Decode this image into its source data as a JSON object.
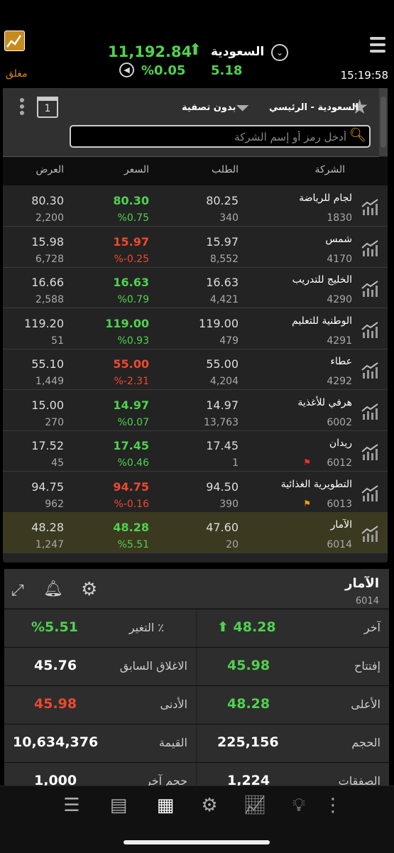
{
  "header": {
    "market_name": "السعودية",
    "index_value": "11,192.84",
    "change_pct": "%0.05",
    "change_value": "5.18",
    "time": "15:19:58",
    "status": "مغلق"
  },
  "filter_bar": {
    "market": "السعودية - الرئيسي",
    "filter": "بدون تصفية",
    "calendar_day": "1"
  },
  "search": {
    "placeholder": "أدخل رمز أو إسم الشركة"
  },
  "table": {
    "columns": [
      "الشركة",
      "الطلب",
      "السعر",
      "العرض"
    ],
    "rows": [
      {
        "name": "لجام للرياضة",
        "symbol": "1830",
        "bid": "80.25",
        "bid_qty": "340",
        "price": "80.30",
        "change": "%0.75",
        "ask": "80.30",
        "ask_qty": "2,200",
        "dir": "up",
        "flag": ""
      },
      {
        "name": "شمس",
        "symbol": "4170",
        "bid": "15.97",
        "bid_qty": "8,552",
        "price": "15.97",
        "change": "%-0.25",
        "ask": "15.98",
        "ask_qty": "6,728",
        "dir": "down",
        "flag": ""
      },
      {
        "name": "الخليج للتدريب",
        "symbol": "4290",
        "bid": "16.63",
        "bid_qty": "4,421",
        "price": "16.63",
        "change": "%0.79",
        "ask": "16.66",
        "ask_qty": "2,588",
        "dir": "up",
        "flag": ""
      },
      {
        "name": "الوطنية للتعليم",
        "symbol": "4291",
        "bid": "119.00",
        "bid_qty": "479",
        "price": "119.00",
        "change": "%0.93",
        "ask": "119.20",
        "ask_qty": "51",
        "dir": "up",
        "flag": ""
      },
      {
        "name": "عطاء",
        "symbol": "4292",
        "bid": "55.00",
        "bid_qty": "4,204",
        "price": "55.00",
        "change": "%-2.31",
        "ask": "55.10",
        "ask_qty": "1,449",
        "dir": "down",
        "flag": ""
      },
      {
        "name": "هرفي للأغذية",
        "symbol": "6002",
        "bid": "14.97",
        "bid_qty": "13,763",
        "price": "14.97",
        "change": "%0.07",
        "ask": "15.00",
        "ask_qty": "270",
        "dir": "up",
        "flag": ""
      },
      {
        "name": "ريدان",
        "symbol": "6012",
        "bid": "17.45",
        "bid_qty": "1",
        "price": "17.45",
        "change": "%0.46",
        "ask": "17.52",
        "ask_qty": "45",
        "dir": "up",
        "flag": "red"
      },
      {
        "name": "التطويرية الغذائية",
        "symbol": "6013",
        "bid": "94.50",
        "bid_qty": "390",
        "price": "94.75",
        "change": "%-0.16",
        "ask": "94.75",
        "ask_qty": "962",
        "dir": "down",
        "flag": "orange"
      },
      {
        "name": "الآمار",
        "symbol": "6014",
        "bid": "47.60",
        "bid_qty": "20",
        "price": "48.28",
        "change": "%5.51",
        "ask": "48.28",
        "ask_qty": "1,247",
        "dir": "up",
        "flag": ""
      }
    ]
  },
  "detail": {
    "name": "الآمار",
    "symbol": "6014",
    "last_label": "آخر",
    "last": "48.28",
    "change_label": "التغير ٪",
    "change": "%5.51",
    "open_label": "إفتتاح",
    "open": "45.98",
    "prev_close_label": "الاغلاق السابق",
    "prev_close": "45.76",
    "high_label": "الأعلى",
    "high": "48.28",
    "low_label": "الأدنى",
    "low": "45.98",
    "volume_label": "الحجم",
    "volume": "225,156",
    "value_label": "القيمة",
    "value": "10,634,376",
    "trades_label": "الصفقات",
    "trades": "1,224",
    "last_qty_label": "حجم آخر",
    "last_qty": "1,000"
  },
  "colors": {
    "up": "#4fd24f",
    "down": "#f0482f",
    "accent": "#e8a21b"
  },
  "tabs": [
    "list-icon",
    "document-icon",
    "table-icon",
    "settings-board-icon",
    "chart-icon",
    "bulb-icon",
    "more-icon"
  ]
}
